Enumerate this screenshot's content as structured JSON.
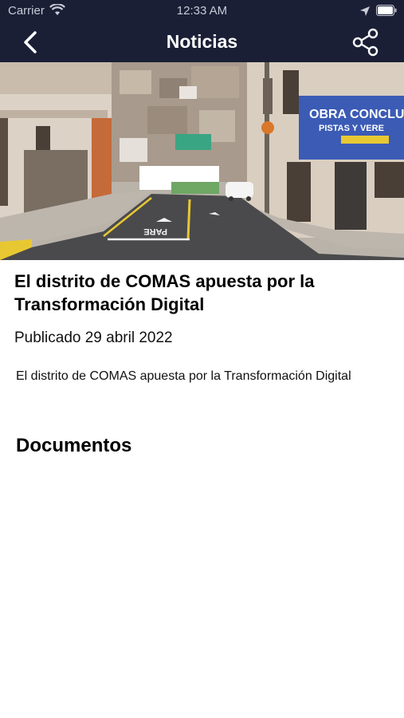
{
  "status_bar": {
    "carrier": "Carrier",
    "time": "12:33 AM",
    "icons": [
      "wifi-icon",
      "location-icon",
      "battery-icon"
    ]
  },
  "nav": {
    "title": "Noticias",
    "back_icon": "chevron-left-icon",
    "share_icon": "share-icon"
  },
  "article": {
    "title": "El distrito de COMAS apuesta por la Transformación Digital",
    "date": "Publicado 29 abril 2022",
    "body": "El distrito de COMAS apuesta por la Transformación Digital"
  },
  "documents": {
    "heading": "Documentos"
  },
  "hero": {
    "banner_line1": "OBRA CONCLU",
    "banner_line2": "PISTAS Y VERE",
    "road_text": "PARE"
  },
  "colors": {
    "nav_background": "#1a1f36",
    "nav_text": "#ffffff"
  }
}
